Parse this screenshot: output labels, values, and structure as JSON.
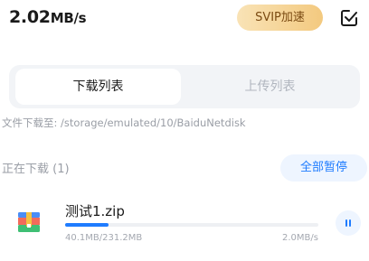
{
  "header": {
    "speed_value": "2.02",
    "speed_unit": "MB/s",
    "svip_label": "SVIP加速",
    "check_icon": "check-square-icon"
  },
  "tabs": [
    {
      "label": "下载列表",
      "active": true
    },
    {
      "label": "上传列表",
      "active": false
    }
  ],
  "download_path": "文件下载至: /storage/emulated/10/BaiduNetdisk",
  "section": {
    "title": "正在下载 (1)",
    "pause_all_label": "全部暂停"
  },
  "items": [
    {
      "name": "测试1.zip",
      "size": "40.1MB/231.2MB",
      "rate": "2.0MB/s",
      "progress": 0.173,
      "icon": "zip-archive-icon",
      "action_icon": "pause-icon"
    }
  ],
  "colors": {
    "accent": "#1f7cff",
    "svip_gold": "#f3c97f"
  }
}
